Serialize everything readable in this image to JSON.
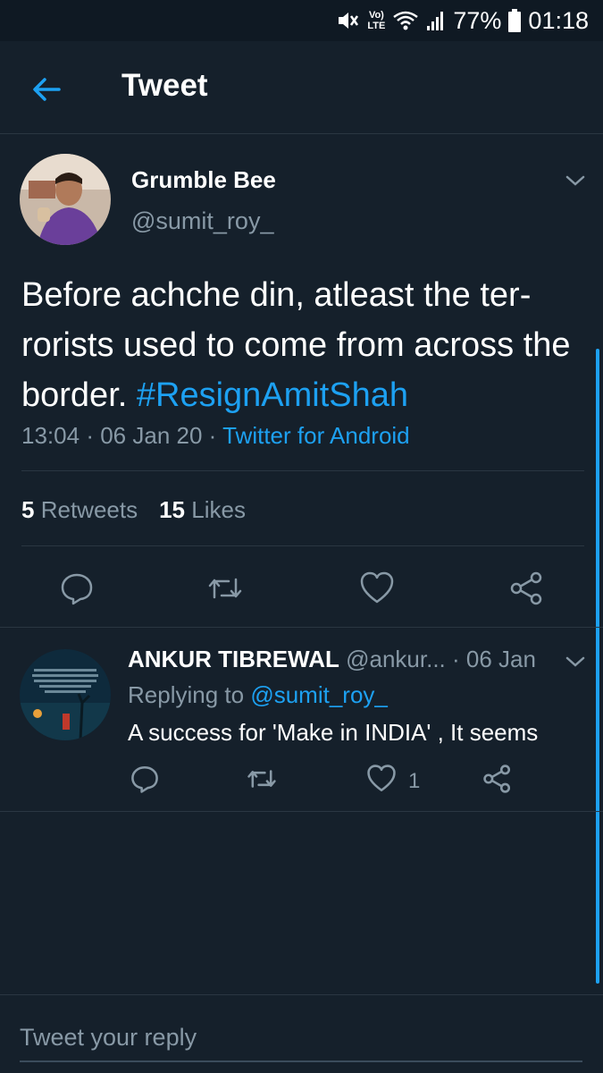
{
  "status_bar": {
    "battery": "77%",
    "time": "01:18",
    "network": "LTE",
    "volte": "Vo)",
    "icons": [
      "mute-icon",
      "volte-icon",
      "wifi-icon",
      "signal-icon",
      "battery-icon"
    ]
  },
  "header": {
    "title": "Tweet",
    "back_icon": "arrow-left-icon"
  },
  "tweet": {
    "author_name": "Grumble Bee",
    "author_handle": "@sumit_roy_",
    "text": "Before achche din, atleast the ter­rorists used to come from across the border. ",
    "hashtag": "#ResignAmitShah",
    "time": "13:04",
    "date": "06 Jan 20",
    "separator": "·",
    "source": "Twitter for Android",
    "retweet_count": "5",
    "retweet_label": "Retweets",
    "like_count": "15",
    "like_label": "Likes"
  },
  "reply": {
    "author_name": "ANKUR TIBREWAL",
    "author_handle": "@ankur...",
    "date": "· 06 Jan",
    "replying_to_label": "Replying to ",
    "replying_to_handle": "@sumit_roy_",
    "text": "A success for 'Make in INDIA' , It seems",
    "like_count": "1"
  },
  "compose": {
    "placeholder": "Tweet your reply"
  },
  "colors": {
    "background": "#15202b",
    "accent": "#1da1f2",
    "secondary_text": "#8899a6",
    "divider": "#2a3642"
  }
}
